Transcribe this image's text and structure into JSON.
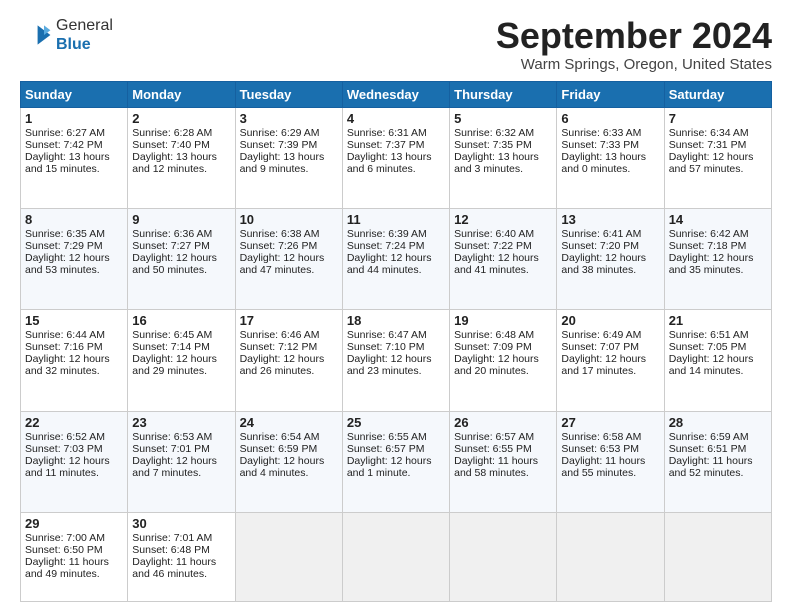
{
  "logo": {
    "line1": "General",
    "line2": "Blue"
  },
  "header": {
    "month": "September 2024",
    "location": "Warm Springs, Oregon, United States"
  },
  "days_of_week": [
    "Sunday",
    "Monday",
    "Tuesday",
    "Wednesday",
    "Thursday",
    "Friday",
    "Saturday"
  ],
  "weeks": [
    [
      {
        "day": "1",
        "sunrise": "6:27 AM",
        "sunset": "7:42 PM",
        "daylight": "13 hours and 15 minutes."
      },
      {
        "day": "2",
        "sunrise": "6:28 AM",
        "sunset": "7:40 PM",
        "daylight": "13 hours and 12 minutes."
      },
      {
        "day": "3",
        "sunrise": "6:29 AM",
        "sunset": "7:39 PM",
        "daylight": "13 hours and 9 minutes."
      },
      {
        "day": "4",
        "sunrise": "6:31 AM",
        "sunset": "7:37 PM",
        "daylight": "13 hours and 6 minutes."
      },
      {
        "day": "5",
        "sunrise": "6:32 AM",
        "sunset": "7:35 PM",
        "daylight": "13 hours and 3 minutes."
      },
      {
        "day": "6",
        "sunrise": "6:33 AM",
        "sunset": "7:33 PM",
        "daylight": "13 hours and 0 minutes."
      },
      {
        "day": "7",
        "sunrise": "6:34 AM",
        "sunset": "7:31 PM",
        "daylight": "12 hours and 57 minutes."
      }
    ],
    [
      {
        "day": "8",
        "sunrise": "6:35 AM",
        "sunset": "7:29 PM",
        "daylight": "12 hours and 53 minutes."
      },
      {
        "day": "9",
        "sunrise": "6:36 AM",
        "sunset": "7:27 PM",
        "daylight": "12 hours and 50 minutes."
      },
      {
        "day": "10",
        "sunrise": "6:38 AM",
        "sunset": "7:26 PM",
        "daylight": "12 hours and 47 minutes."
      },
      {
        "day": "11",
        "sunrise": "6:39 AM",
        "sunset": "7:24 PM",
        "daylight": "12 hours and 44 minutes."
      },
      {
        "day": "12",
        "sunrise": "6:40 AM",
        "sunset": "7:22 PM",
        "daylight": "12 hours and 41 minutes."
      },
      {
        "day": "13",
        "sunrise": "6:41 AM",
        "sunset": "7:20 PM",
        "daylight": "12 hours and 38 minutes."
      },
      {
        "day": "14",
        "sunrise": "6:42 AM",
        "sunset": "7:18 PM",
        "daylight": "12 hours and 35 minutes."
      }
    ],
    [
      {
        "day": "15",
        "sunrise": "6:44 AM",
        "sunset": "7:16 PM",
        "daylight": "12 hours and 32 minutes."
      },
      {
        "day": "16",
        "sunrise": "6:45 AM",
        "sunset": "7:14 PM",
        "daylight": "12 hours and 29 minutes."
      },
      {
        "day": "17",
        "sunrise": "6:46 AM",
        "sunset": "7:12 PM",
        "daylight": "12 hours and 26 minutes."
      },
      {
        "day": "18",
        "sunrise": "6:47 AM",
        "sunset": "7:10 PM",
        "daylight": "12 hours and 23 minutes."
      },
      {
        "day": "19",
        "sunrise": "6:48 AM",
        "sunset": "7:09 PM",
        "daylight": "12 hours and 20 minutes."
      },
      {
        "day": "20",
        "sunrise": "6:49 AM",
        "sunset": "7:07 PM",
        "daylight": "12 hours and 17 minutes."
      },
      {
        "day": "21",
        "sunrise": "6:51 AM",
        "sunset": "7:05 PM",
        "daylight": "12 hours and 14 minutes."
      }
    ],
    [
      {
        "day": "22",
        "sunrise": "6:52 AM",
        "sunset": "7:03 PM",
        "daylight": "12 hours and 11 minutes."
      },
      {
        "day": "23",
        "sunrise": "6:53 AM",
        "sunset": "7:01 PM",
        "daylight": "12 hours and 7 minutes."
      },
      {
        "day": "24",
        "sunrise": "6:54 AM",
        "sunset": "6:59 PM",
        "daylight": "12 hours and 4 minutes."
      },
      {
        "day": "25",
        "sunrise": "6:55 AM",
        "sunset": "6:57 PM",
        "daylight": "12 hours and 1 minute."
      },
      {
        "day": "26",
        "sunrise": "6:57 AM",
        "sunset": "6:55 PM",
        "daylight": "11 hours and 58 minutes."
      },
      {
        "day": "27",
        "sunrise": "6:58 AM",
        "sunset": "6:53 PM",
        "daylight": "11 hours and 55 minutes."
      },
      {
        "day": "28",
        "sunrise": "6:59 AM",
        "sunset": "6:51 PM",
        "daylight": "11 hours and 52 minutes."
      }
    ],
    [
      {
        "day": "29",
        "sunrise": "7:00 AM",
        "sunset": "6:50 PM",
        "daylight": "11 hours and 49 minutes."
      },
      {
        "day": "30",
        "sunrise": "7:01 AM",
        "sunset": "6:48 PM",
        "daylight": "11 hours and 46 minutes."
      },
      null,
      null,
      null,
      null,
      null
    ]
  ]
}
